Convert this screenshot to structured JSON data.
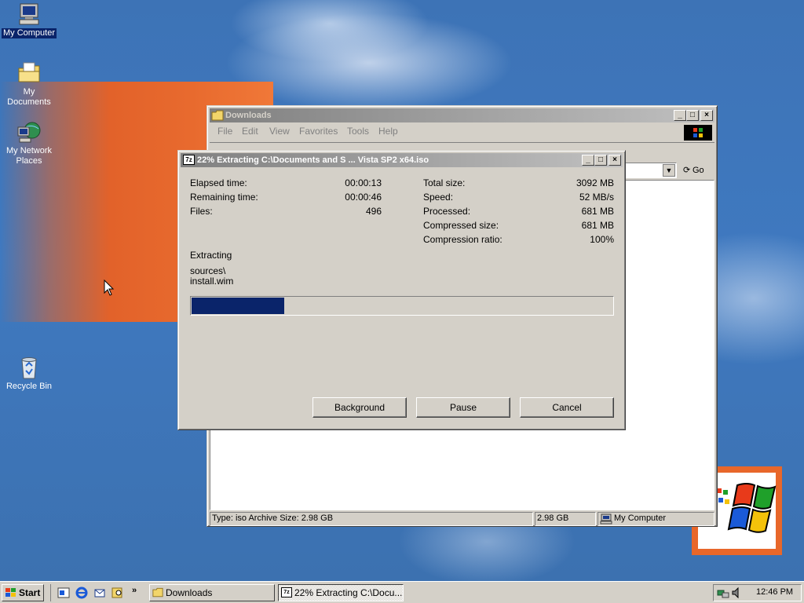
{
  "desktop": {
    "icons": [
      {
        "label": "My Computer"
      },
      {
        "label": "My Documents"
      },
      {
        "label": "My Network Places"
      },
      {
        "label": "Recycle Bin"
      }
    ]
  },
  "explorer": {
    "title": "Downloads",
    "menu": [
      "File",
      "Edit",
      "View",
      "Favorites",
      "Tools",
      "Help"
    ],
    "go_label": "Go",
    "status": {
      "type_text": "Type: iso Archive Size: 2.98 GB",
      "size": "2.98 GB",
      "zone": "My Computer"
    }
  },
  "dialog": {
    "title": "22% Extracting C:\\Documents and S ...  Vista SP2 x64.iso",
    "app_icon_text": "7z",
    "stats_left": [
      {
        "label": "Elapsed time:",
        "value": "00:00:13"
      },
      {
        "label": "Remaining time:",
        "value": "00:00:46"
      },
      {
        "label": "Files:",
        "value": "496"
      }
    ],
    "stats_right": [
      {
        "label": "Total size:",
        "value": "3092 MB"
      },
      {
        "label": "Speed:",
        "value": "52 MB/s"
      },
      {
        "label": "Processed:",
        "value": "681 MB"
      },
      {
        "label": "Compressed size:",
        "value": "681 MB"
      },
      {
        "label": "Compression ratio:",
        "value": "100%"
      }
    ],
    "action": "Extracting",
    "current_dir": "sources\\",
    "current_file": "install.wim",
    "progress_fraction": 0.22,
    "buttons": {
      "background": "Background",
      "pause": "Pause",
      "cancel": "Cancel"
    }
  },
  "taskbar": {
    "start_label": "Start",
    "tasks": [
      {
        "label": "Downloads"
      },
      {
        "label": "22% Extracting C:\\Docu..."
      }
    ],
    "clock": "12:46 PM"
  },
  "colors": {
    "desktop": "#3a6ea5",
    "face": "#d4d0c8",
    "active_title": "#0a246a",
    "progress": "#0a246a",
    "orange": "#e2622a"
  }
}
